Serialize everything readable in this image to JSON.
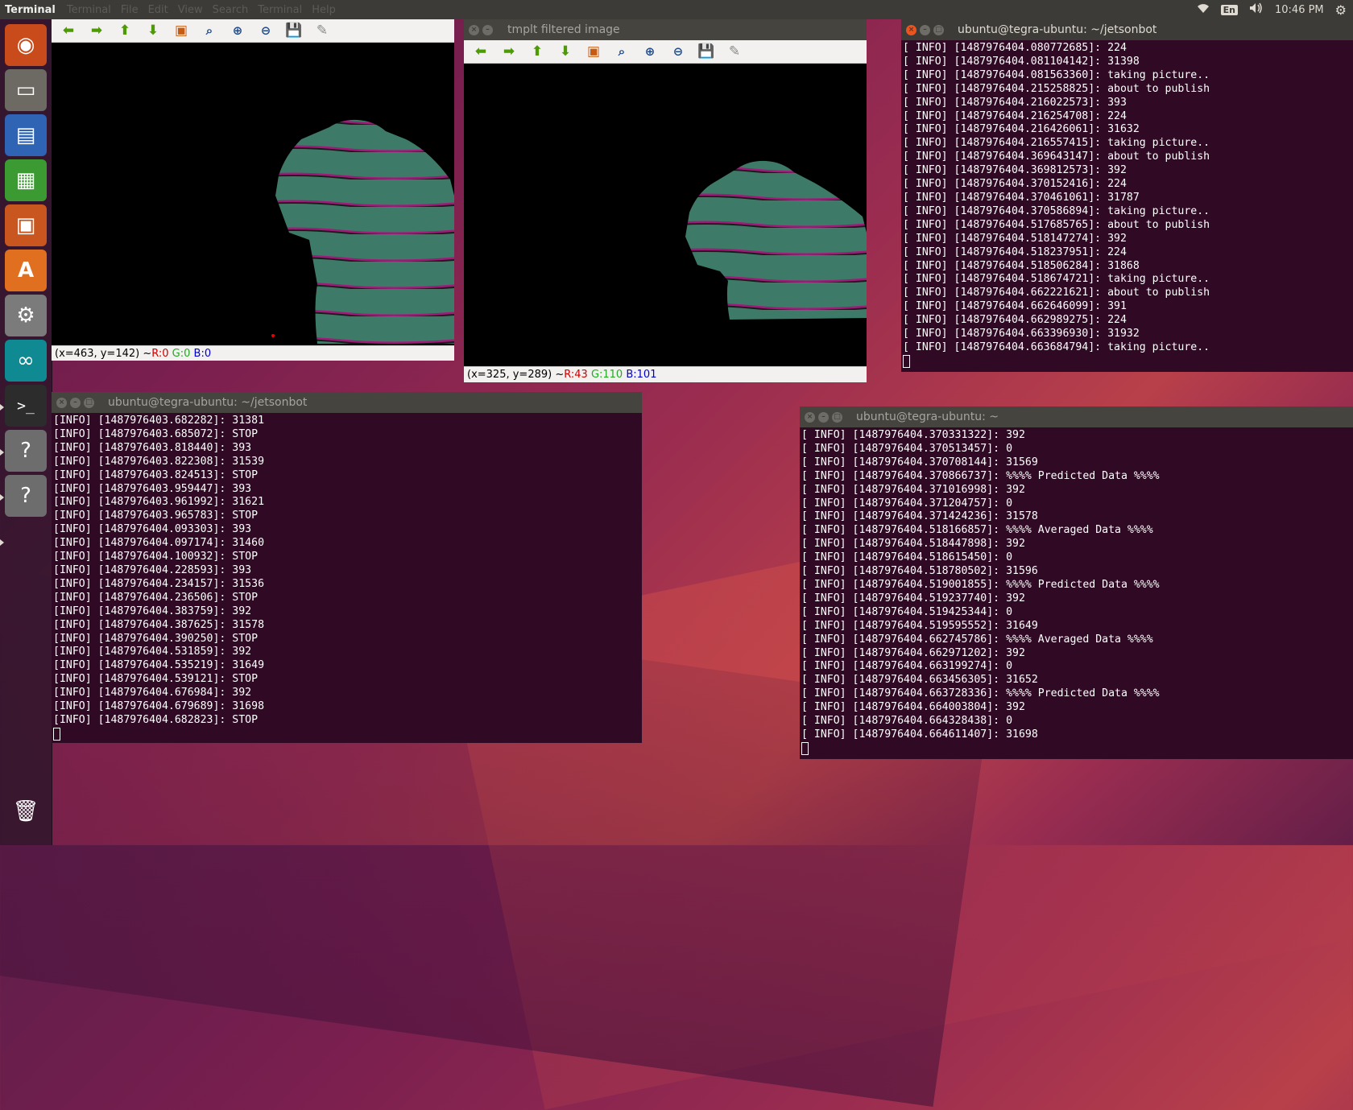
{
  "panel": {
    "app_title": "Terminal",
    "menus": [
      "Terminal",
      "File",
      "Edit",
      "View",
      "Search",
      "Terminal",
      "Help"
    ],
    "lang": "En",
    "clock": "10:46 PM"
  },
  "launcher": {
    "items": [
      {
        "name": "ubuntu-dash-icon",
        "glyph": "◉",
        "bg": "#c94a1a"
      },
      {
        "name": "files-icon",
        "glyph": "▭",
        "bg": "#6d6a64"
      },
      {
        "name": "writer-icon",
        "glyph": "▤",
        "bg": "#2f63b4"
      },
      {
        "name": "calc-icon",
        "glyph": "▦",
        "bg": "#3c9a33"
      },
      {
        "name": "impress-icon",
        "glyph": "▣",
        "bg": "#c8561e"
      },
      {
        "name": "software-center-icon",
        "glyph": "A",
        "bg": "#e0701f"
      },
      {
        "name": "system-settings-icon",
        "glyph": "⚙",
        "bg": "#7b7b7b"
      },
      {
        "name": "arduino-icon",
        "glyph": "∞",
        "bg": "#0f8a93"
      },
      {
        "name": "terminal-icon",
        "glyph": ">_",
        "bg": "#2c2c2c"
      },
      {
        "name": "unknown-app-icon",
        "glyph": "?",
        "bg": "#6d6d6d"
      },
      {
        "name": "unknown-app-2-icon",
        "glyph": "?",
        "bg": "#6d6d6d"
      },
      {
        "name": "trash-icon",
        "glyph": "🗑",
        "bg": "transparent"
      }
    ]
  },
  "img_window_1": {
    "title": "",
    "status": {
      "coords": "(x=463, y=142) ~ ",
      "r": "R:0",
      "g": "G:0",
      "b": "B:0"
    }
  },
  "img_window_2": {
    "title": "tmplt filtered image",
    "status": {
      "coords": "(x=325, y=289) ~ ",
      "r": "R:43",
      "g": "G:110",
      "b": "B:101"
    }
  },
  "term_right": {
    "title": "ubuntu@tegra-ubuntu: ~/jetsonbot",
    "lines": [
      "[ INFO] [1487976404.080772685]: 224",
      "[ INFO] [1487976404.081104142]: 31398",
      "[ INFO] [1487976404.081563360]: taking picture..",
      "[ INFO] [1487976404.215258825]: about to publish",
      "[ INFO] [1487976404.216022573]: 393",
      "[ INFO] [1487976404.216254708]: 224",
      "[ INFO] [1487976404.216426061]: 31632",
      "[ INFO] [1487976404.216557415]: taking picture..",
      "[ INFO] [1487976404.369643147]: about to publish",
      "[ INFO] [1487976404.369812573]: 392",
      "[ INFO] [1487976404.370152416]: 224",
      "[ INFO] [1487976404.370461061]: 31787",
      "[ INFO] [1487976404.370586894]: taking picture..",
      "[ INFO] [1487976404.517685765]: about to publish",
      "[ INFO] [1487976404.518147274]: 392",
      "[ INFO] [1487976404.518237951]: 224",
      "[ INFO] [1487976404.518506284]: 31868",
      "[ INFO] [1487976404.518674721]: taking picture..",
      "[ INFO] [1487976404.662221621]: about to publish",
      "[ INFO] [1487976404.662646099]: 391",
      "[ INFO] [1487976404.662989275]: 224",
      "[ INFO] [1487976404.663396930]: 31932",
      "[ INFO] [1487976404.663684794]: taking picture.."
    ]
  },
  "term_left": {
    "title": "ubuntu@tegra-ubuntu: ~/jetsonbot",
    "lines": [
      "[INFO] [1487976403.682282]: 31381",
      "[INFO] [1487976403.685072]: STOP",
      "[INFO] [1487976403.818440]: 393",
      "[INFO] [1487976403.822308]: 31539",
      "[INFO] [1487976403.824513]: STOP",
      "[INFO] [1487976403.959447]: 393",
      "[INFO] [1487976403.961992]: 31621",
      "[INFO] [1487976403.965783]: STOP",
      "[INFO] [1487976404.093303]: 393",
      "[INFO] [1487976404.097174]: 31460",
      "[INFO] [1487976404.100932]: STOP",
      "[INFO] [1487976404.228593]: 393",
      "[INFO] [1487976404.234157]: 31536",
      "[INFO] [1487976404.236506]: STOP",
      "[INFO] [1487976404.383759]: 392",
      "[INFO] [1487976404.387625]: 31578",
      "[INFO] [1487976404.390250]: STOP",
      "[INFO] [1487976404.531859]: 392",
      "[INFO] [1487976404.535219]: 31649",
      "[INFO] [1487976404.539121]: STOP",
      "[INFO] [1487976404.676984]: 392",
      "[INFO] [1487976404.679689]: 31698",
      "[INFO] [1487976404.682823]: STOP"
    ]
  },
  "term_bottom_right": {
    "title": "ubuntu@tegra-ubuntu: ~",
    "lines": [
      "[ INFO] [1487976404.370331322]: 392",
      "[ INFO] [1487976404.370513457]: 0",
      "[ INFO] [1487976404.370708144]: 31569",
      "[ INFO] [1487976404.370866737]: %%%% Predicted Data %%%%",
      "[ INFO] [1487976404.371016998]: 392",
      "[ INFO] [1487976404.371204757]: 0",
      "[ INFO] [1487976404.371424236]: 31578",
      "[ INFO] [1487976404.518166857]: %%%% Averaged Data %%%%",
      "[ INFO] [1487976404.518447898]: 392",
      "[ INFO] [1487976404.518615450]: 0",
      "[ INFO] [1487976404.518780502]: 31596",
      "[ INFO] [1487976404.519001855]: %%%% Predicted Data %%%%",
      "[ INFO] [1487976404.519237740]: 392",
      "[ INFO] [1487976404.519425344]: 0",
      "[ INFO] [1487976404.519595552]: 31649",
      "[ INFO] [1487976404.662745786]: %%%% Averaged Data %%%%",
      "[ INFO] [1487976404.662971202]: 392",
      "[ INFO] [1487976404.663199274]: 0",
      "[ INFO] [1487976404.663456305]: 31652",
      "[ INFO] [1487976404.663728336]: %%%% Predicted Data %%%%",
      "[ INFO] [1487976404.664003804]: 392",
      "[ INFO] [1487976404.664328438]: 0",
      "[ INFO] [1487976404.664611407]: 31698"
    ]
  }
}
